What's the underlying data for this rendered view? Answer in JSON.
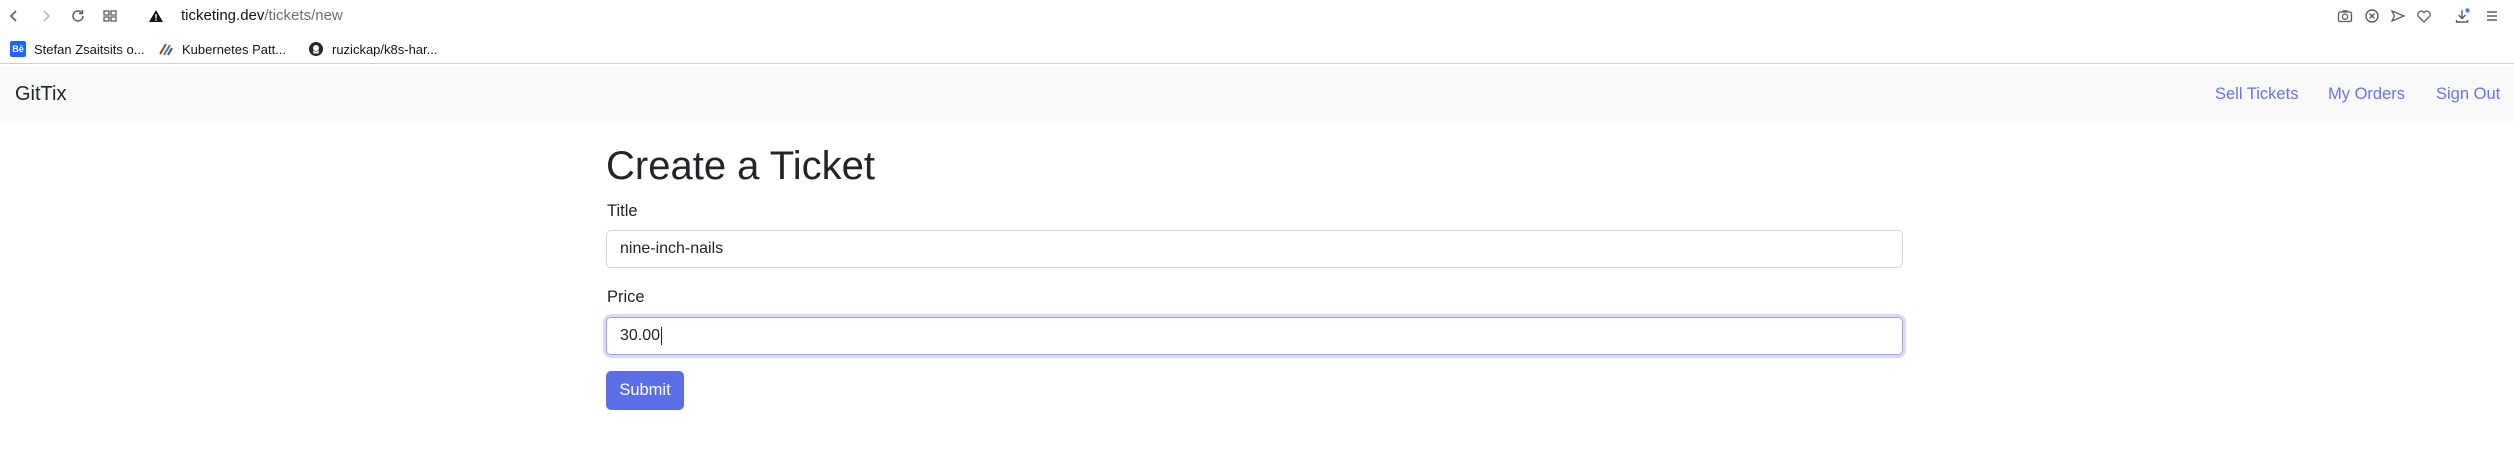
{
  "browser": {
    "url_domain": "ticketing.dev",
    "url_path": "/tickets/new",
    "bookmarks": [
      {
        "label": "Stefan Zsaitsits o...",
        "icon": "behance-icon"
      },
      {
        "label": "Kubernetes Patt...",
        "icon": "kubernetes-patterns-icon"
      },
      {
        "label": "ruzickap/k8s-har...",
        "icon": "github-icon"
      }
    ]
  },
  "app": {
    "brand": "GitTix",
    "nav": {
      "sell_tickets": "Sell Tickets",
      "my_orders": "My Orders",
      "sign_out": "Sign Out"
    }
  },
  "form": {
    "heading": "Create a Ticket",
    "title_label": "Title",
    "title_value": "nine-inch-nails",
    "price_label": "Price",
    "price_value": "30.00",
    "submit_label": "Submit"
  },
  "colors": {
    "primary": "#5b6ee6",
    "link": "#6c73e4",
    "navbar_bg": "#f8f9fa"
  }
}
